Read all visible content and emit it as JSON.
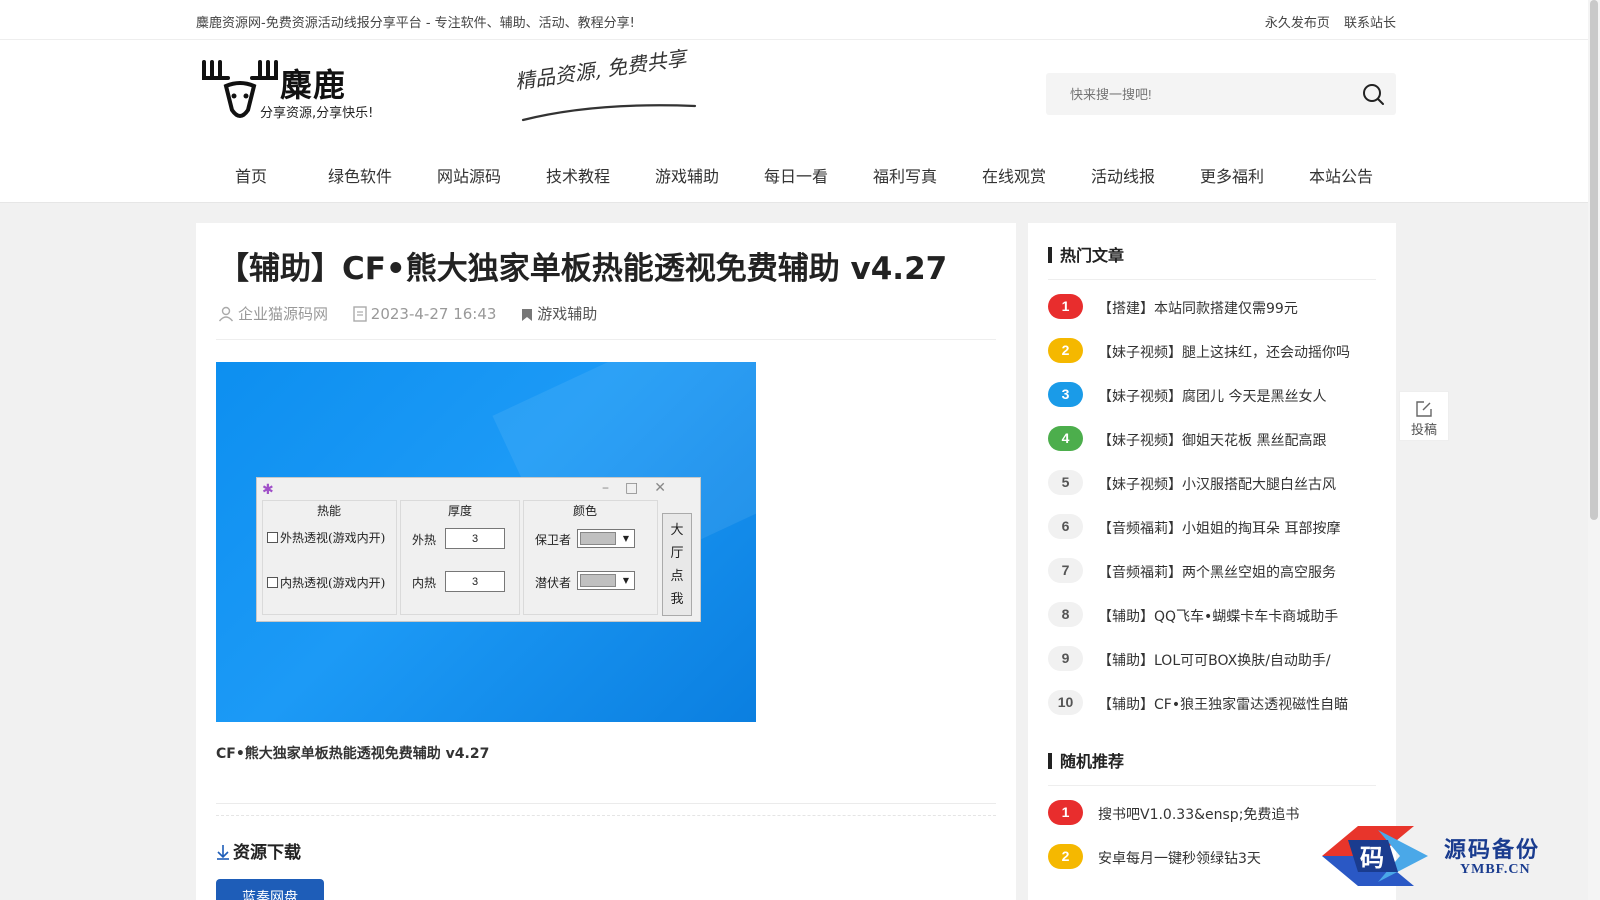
{
  "topbar": {
    "notice": "麋鹿资源网-免费资源活动线报分享平台 - 专注软件、辅助、活动、教程分享!",
    "links": [
      "永久发布页",
      "联系站长"
    ]
  },
  "logo": {
    "brand": "麋鹿",
    "slogan": "分享资源,分享快乐!"
  },
  "header_art": "精品资源, 免费共享",
  "search": {
    "placeholder": "快来搜一搜吧!"
  },
  "nav": [
    "首页",
    "绿色软件",
    "网站源码",
    "技术教程",
    "游戏辅助",
    "每日一看",
    "福利写真",
    "在线观赏",
    "活动线报",
    "更多福利",
    "本站公告"
  ],
  "article": {
    "title": "【辅助】CF•熊大独家单板热能透视免费辅助 v4.27",
    "author": "企业猫源码网",
    "date": "2023-4-27 16:43",
    "category": "游戏辅助",
    "caption": "CF•熊大独家单板热能透视免费辅助 v4.27",
    "download_title": "资源下载",
    "download_button": "蓝奏网盘"
  },
  "app_window": {
    "col_heads": [
      "热能",
      "厚度",
      "颜色"
    ],
    "check1": "外热透视(游戏内开)",
    "check2": "内热透视(游戏内开)",
    "label_outer": "外热",
    "label_inner": "内热",
    "outer_value": "3",
    "inner_value": "3",
    "label_guard": "保卫者",
    "label_lurker": "潜伏者",
    "side_button": "大厅点我",
    "side_chars": [
      "大",
      "厅",
      "点",
      "我"
    ]
  },
  "sidebar": {
    "hot_title": "热门文章",
    "hot": [
      {
        "n": "1",
        "t": "【搭建】本站同款搭建仅需99元"
      },
      {
        "n": "2",
        "t": "【妹子视频】腿上这抹红，还会动摇你吗"
      },
      {
        "n": "3",
        "t": "【妹子视频】腐团儿 今天是黑丝女人"
      },
      {
        "n": "4",
        "t": "【妹子视频】御姐天花板 黑丝配高跟"
      },
      {
        "n": "5",
        "t": "【妹子视频】小汉服搭配大腿白丝古风"
      },
      {
        "n": "6",
        "t": "【音频福莉】小姐姐的掏耳朵 耳部按摩"
      },
      {
        "n": "7",
        "t": "【音频福莉】两个黑丝空姐的高空服务"
      },
      {
        "n": "8",
        "t": "【辅助】QQ飞车•蝴蝶卡车卡商城助手"
      },
      {
        "n": "9",
        "t": "【辅助】LOL可可BOX换肤/自动助手/"
      },
      {
        "n": "10",
        "t": "【辅助】CF•狼王独家雷达透视磁性自瞄"
      }
    ],
    "rand_title": "随机推荐",
    "rand": [
      {
        "n": "1",
        "t": "搜书吧V1.0.33&ensp;免费追书"
      },
      {
        "n": "2",
        "t": "安卓每月一键秒领绿钻3天"
      }
    ]
  },
  "float_button": "投稿",
  "watermark": {
    "text1": "源码备份",
    "text2": "YMBF.CN",
    "icon_char": "码"
  },
  "colors": {
    "rank1": "#e82d2d",
    "rank2": "#f5b800",
    "rank3": "#1a9be8",
    "rank4": "#4cae4c",
    "download": "#1e5db8"
  }
}
